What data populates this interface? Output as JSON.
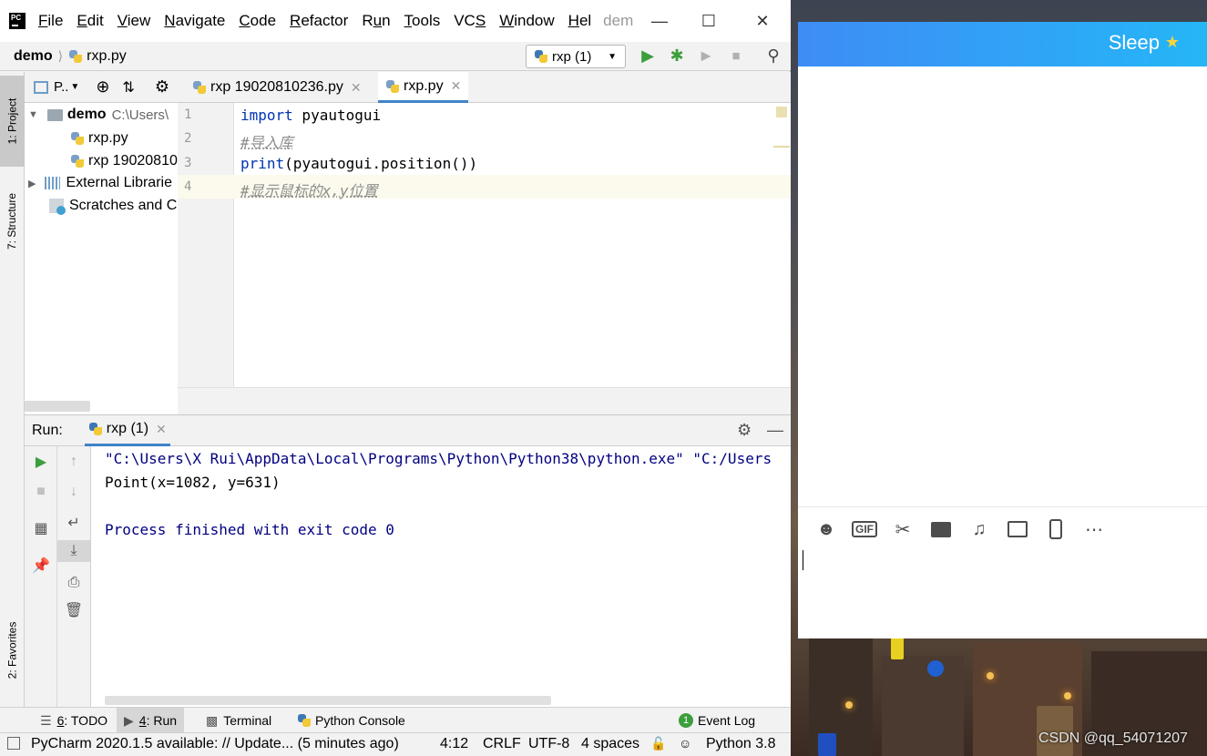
{
  "ide": {
    "menu": [
      {
        "pre": "",
        "ul": "F",
        "post": "ile"
      },
      {
        "pre": "",
        "ul": "E",
        "post": "dit"
      },
      {
        "pre": "",
        "ul": "V",
        "post": "iew"
      },
      {
        "pre": "",
        "ul": "N",
        "post": "avigate"
      },
      {
        "pre": "",
        "ul": "C",
        "post": "ode"
      },
      {
        "pre": "",
        "ul": "R",
        "post": "efactor"
      },
      {
        "pre": "R",
        "ul": "u",
        "post": "n"
      },
      {
        "pre": "",
        "ul": "T",
        "post": "ools"
      },
      {
        "pre": "VC",
        "ul": "S",
        "post": ""
      },
      {
        "pre": "",
        "ul": "W",
        "post": "indow"
      },
      {
        "pre": "",
        "ul": "H",
        "post": "el"
      }
    ],
    "window_title": "dem",
    "breadcrumb": {
      "project": "demo",
      "file": "rxp.py"
    },
    "run_config": "rxp (1)",
    "left_stripe": {
      "project": "1: Project",
      "structure": "7: Structure",
      "favorites": "2: Favorites"
    },
    "project_panel": {
      "view_label": "P..",
      "root": {
        "name": "demo",
        "path": "C:\\Users\\"
      },
      "files": [
        "rxp.py",
        "rxp 19020810"
      ],
      "external": "External Librarie",
      "scratches": "Scratches and Co"
    },
    "editor": {
      "tabs": [
        "rxp 19020810236.py",
        "rxp.py"
      ],
      "line_numbers": [
        "1",
        "2",
        "3",
        "4"
      ],
      "lines": {
        "l1_kw": "import",
        "l1_rest": " pyautogui",
        "l2": "#导入库",
        "l3_kw": "print",
        "l3_rest": "(pyautogui.position())",
        "l4": "#显示鼠标的x,y位置"
      }
    },
    "run": {
      "label": "Run:",
      "tab": "rxp (1)",
      "output": [
        "\"C:\\Users\\X Rui\\AppData\\Local\\Programs\\Python\\Python38\\python.exe\" \"C:/Users",
        "Point(x=1082, y=631)",
        "",
        "Process finished with exit code 0"
      ]
    },
    "bottom_tabs": {
      "todo_ul": "6",
      "todo": ": TODO",
      "run_ul": "4",
      "run": ": Run",
      "terminal": "Terminal",
      "console": "Python Console",
      "event_log": "Event Log",
      "event_count": "1"
    },
    "status": {
      "message": "PyCharm 2020.1.5 available: // Update... (5 minutes ago)",
      "position": "4:12",
      "line_sep": "CRLF",
      "encoding": "UTF-8",
      "indent": "4 spaces",
      "interpreter": "Python 3.8"
    }
  },
  "chat": {
    "contact": "Sleep",
    "tools": [
      "emoji-icon",
      "gif-icon",
      "scissors-icon",
      "folder-icon",
      "music-icon",
      "image-icon",
      "shake-icon",
      "more-icon"
    ],
    "gif_label": "GIF"
  },
  "watermark": "CSDN @qq_54071207",
  "colors": {
    "accent": "#4083c9",
    "keyword": "#0033b3",
    "comment": "#8c8c8c",
    "console_text": "#000080",
    "run_green": "#3c9e3c",
    "chat_header": "#3e8cf5"
  }
}
